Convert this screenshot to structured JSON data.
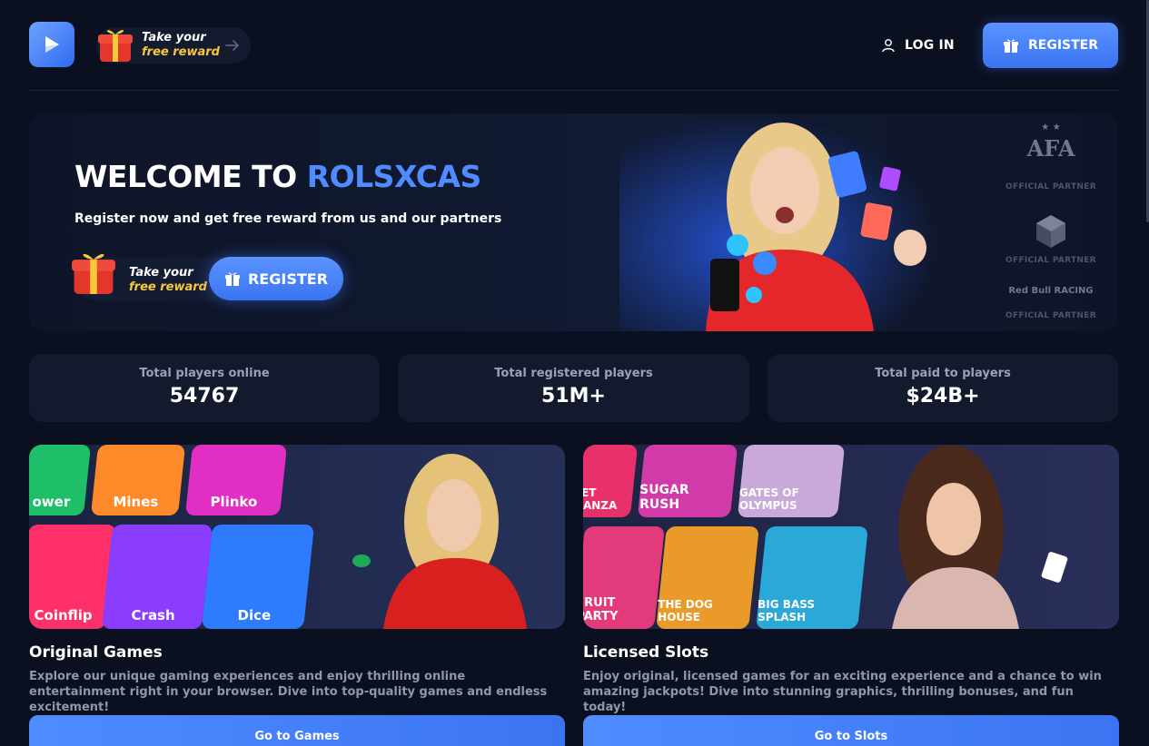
{
  "header": {
    "reward": {
      "line1": "Take your",
      "line2": "free reward"
    },
    "login_label": "LOG IN",
    "register_label": "REGISTER"
  },
  "hero": {
    "title_prefix": "WELCOME TO",
    "title_accent": "ROLSXCAS",
    "subtitle": "Register now and get free reward from us and our partners",
    "reward": {
      "line1": "Take your",
      "line2": "free reward"
    },
    "register_label": "REGISTER",
    "partners": [
      {
        "mark": "AFA",
        "label": "OFFICIAL PARTNER"
      },
      {
        "mark": "",
        "label": "OFFICIAL PARTNER"
      },
      {
        "mark": "Red Bull RACING",
        "label": "OFFICIAL PARTNER"
      }
    ]
  },
  "stats": [
    {
      "label": "Total players online",
      "value": "54767"
    },
    {
      "label": "Total registered players",
      "value": "51M+"
    },
    {
      "label": "Total paid to players",
      "value": "$24B+"
    }
  ],
  "cards": [
    {
      "title": "Original Games",
      "description": "Explore our unique gaming experiences and enjoy thrilling online entertainment right in your browser. Dive into top-quality games and endless excitement!",
      "button": "Go to Games",
      "tiles": [
        "ower",
        "Mines",
        "Plinko",
        "Coinflip",
        "Crash",
        "Dice"
      ]
    },
    {
      "title": "Licensed Slots",
      "description": "Enjoy original, licensed games for an exciting experience and a chance to win amazing jackpots! Dive into stunning graphics, thrilling bonuses, and fun today!",
      "button": "Go to Slots",
      "tiles": [
        "EET NANZA",
        "SUGAR RUSH",
        "GATES OF OLYMPUS",
        "FRUIT PARTY",
        "THE DOG HOUSE",
        "BIG BASS SPLASH"
      ]
    }
  ],
  "colors": {
    "background": "#0b1020",
    "accent": "#4f8cff",
    "reward_yellow": "#f6c93a",
    "panel": "#141a2e"
  }
}
